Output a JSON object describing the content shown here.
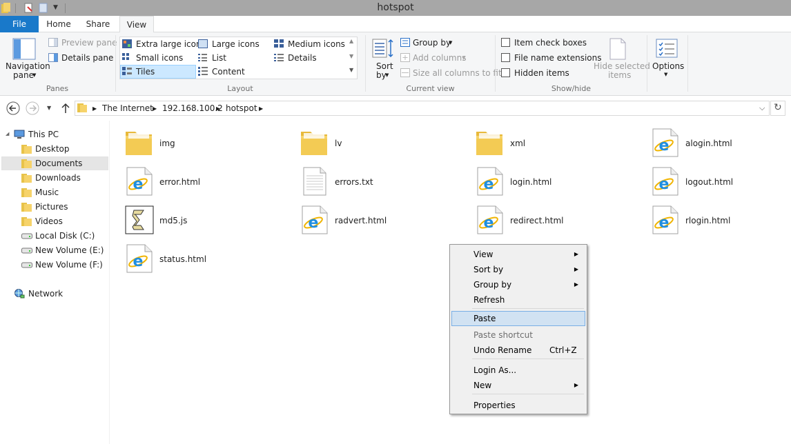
{
  "window": {
    "title": "hotspot"
  },
  "ribbon": {
    "tabs": [
      "File",
      "Home",
      "Share",
      "View"
    ],
    "active_tab": "View",
    "panes": {
      "navigation_pane": "Navigation",
      "navigation_pane_line2": "pane",
      "preview_pane": "Preview pane",
      "details_pane": "Details pane",
      "group_label": "Panes"
    },
    "layout": {
      "extra_large_icons": "Extra large icons",
      "large_icons": "Large icons",
      "medium_icons": "Medium icons",
      "small_icons": "Small icons",
      "list": "List",
      "details": "Details",
      "tiles": "Tiles",
      "content": "Content",
      "selected": "Tiles",
      "group_label": "Layout"
    },
    "current_view": {
      "sort_by": "Sort",
      "sort_by_line2": "by",
      "group_by": "Group by",
      "add_columns": "Add columns",
      "size_all_columns": "Size all columns to fit",
      "group_label": "Current view"
    },
    "show_hide": {
      "item_check_boxes": "Item check boxes",
      "file_name_extensions": "File name extensions",
      "hidden_items": "Hidden items",
      "hide_selected": "Hide selected",
      "hide_selected_line2": "items",
      "group_label": "Show/hide"
    },
    "options": {
      "label": "Options"
    }
  },
  "address": {
    "crumbs": [
      "The Internet",
      "192.168.100.2",
      "hotspot"
    ]
  },
  "nav": {
    "items": [
      {
        "label": "This PC",
        "icon": "computer-icon"
      },
      {
        "label": "Desktop",
        "icon": "folder-icon"
      },
      {
        "label": "Documents",
        "icon": "folder-icon"
      },
      {
        "label": "Downloads",
        "icon": "folder-icon"
      },
      {
        "label": "Music",
        "icon": "folder-icon"
      },
      {
        "label": "Pictures",
        "icon": "folder-icon"
      },
      {
        "label": "Videos",
        "icon": "folder-icon"
      },
      {
        "label": "Local Disk (C:)",
        "icon": "drive-icon"
      },
      {
        "label": "New Volume (E:)",
        "icon": "drive-icon"
      },
      {
        "label": "New Volume (F:)",
        "icon": "drive-icon"
      },
      {
        "label": "Network",
        "icon": "network-icon"
      }
    ],
    "selected": "Documents"
  },
  "files": [
    {
      "name": "img",
      "type": "folder"
    },
    {
      "name": "lv",
      "type": "folder"
    },
    {
      "name": "xml",
      "type": "folder"
    },
    {
      "name": "alogin.html",
      "type": "html"
    },
    {
      "name": "error.html",
      "type": "html"
    },
    {
      "name": "errors.txt",
      "type": "txt"
    },
    {
      "name": "login.html",
      "type": "html"
    },
    {
      "name": "logout.html",
      "type": "html"
    },
    {
      "name": "md5.js",
      "type": "js"
    },
    {
      "name": "radvert.html",
      "type": "html"
    },
    {
      "name": "redirect.html",
      "type": "html"
    },
    {
      "name": "rlogin.html",
      "type": "html"
    },
    {
      "name": "status.html",
      "type": "html"
    }
  ],
  "context_menu": {
    "items": [
      {
        "label": "View",
        "submenu": true
      },
      {
        "label": "Sort by",
        "submenu": true
      },
      {
        "label": "Group by",
        "submenu": true
      },
      {
        "label": "Refresh"
      },
      {
        "label": "Paste",
        "highlighted": true
      },
      {
        "label": "Paste shortcut",
        "disabled": true
      },
      {
        "label": "Undo Rename",
        "shortcut": "Ctrl+Z"
      },
      {
        "label": "Login As..."
      },
      {
        "label": "New",
        "submenu": true
      },
      {
        "label": "Properties"
      }
    ]
  },
  "colors": {
    "accent": "#1979ca",
    "folder": "#f6d36a",
    "selection": "#cce8ff",
    "ie_blue": "#1f8ee0"
  }
}
